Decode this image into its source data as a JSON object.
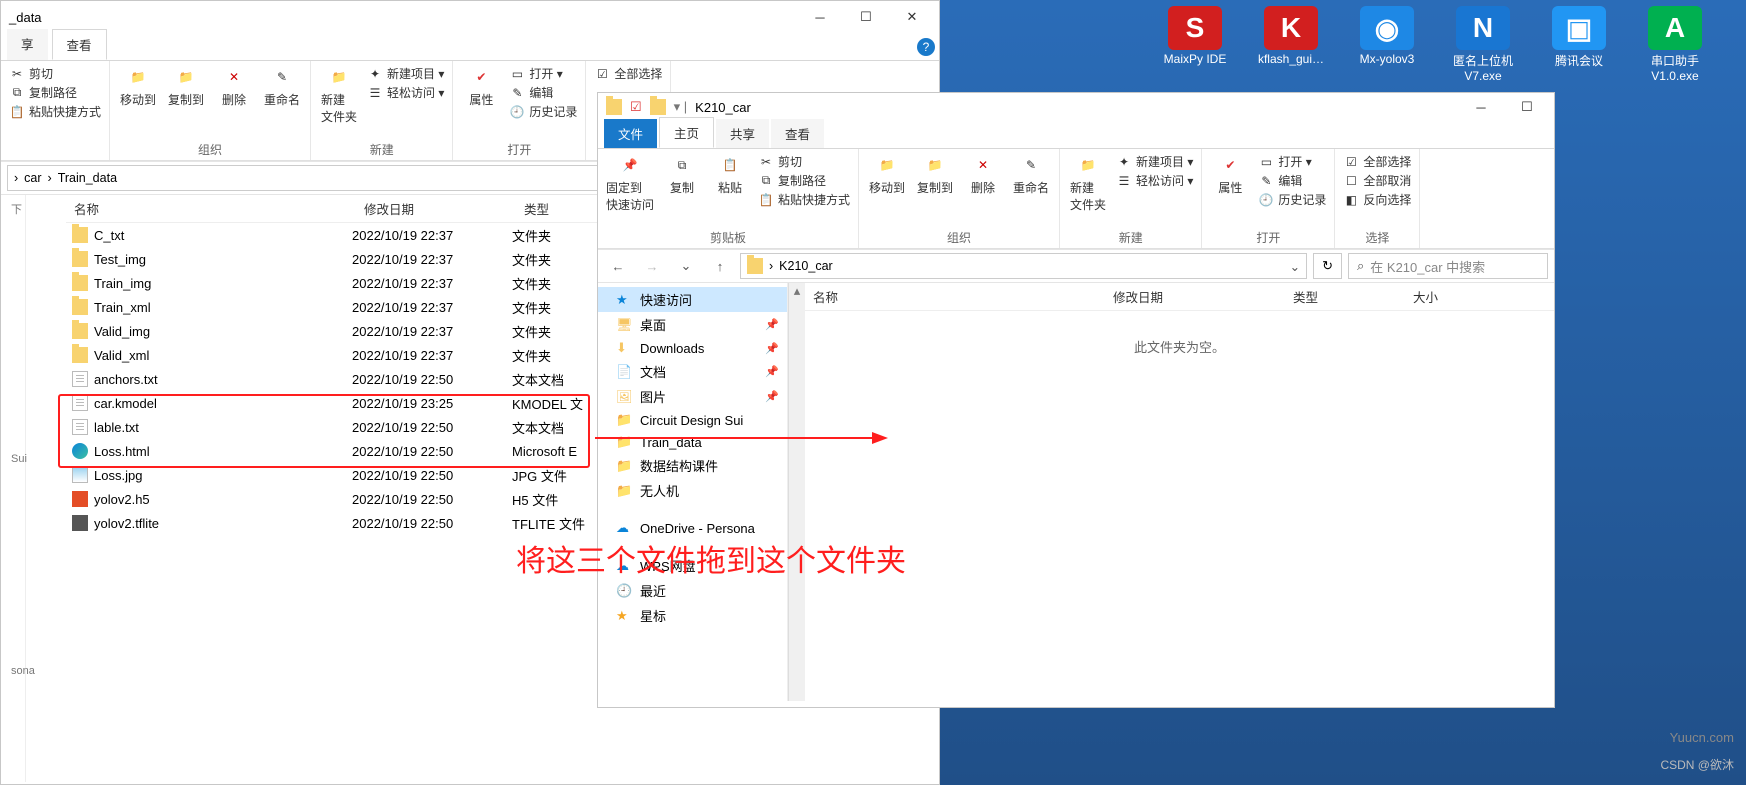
{
  "desktop": {
    "icons": [
      {
        "name": "MaixPy IDE",
        "color": "#d21f1f",
        "glyph": "S"
      },
      {
        "name": "kflash_gui…",
        "color": "#d21f1f",
        "glyph": "K"
      },
      {
        "name": "Mx-yolov3",
        "color": "#1e88e5",
        "glyph": "◉"
      },
      {
        "name": "匿名上位机\nV7.exe",
        "color": "#1976d2",
        "glyph": "N"
      },
      {
        "name": "腾讯会议",
        "color": "#2196f3",
        "glyph": "▣"
      },
      {
        "name": "串口助手\nV1.0.exe",
        "color": "#00b050",
        "glyph": "A"
      }
    ]
  },
  "winA": {
    "title": "_data",
    "tabs": [
      "享",
      "查看"
    ],
    "ribbon": {
      "clipboard": {
        "cut": "剪切",
        "copy": "复制路径",
        "paste": "粘贴快捷方式"
      },
      "org": {
        "move": "移动到",
        "copy": "复制到",
        "del": "删除",
        "rename": "重命名",
        "label": "组织"
      },
      "new": {
        "folder": "新建\n文件夹",
        "newitem": "新建项目 ▾",
        "easy": "轻松访问 ▾",
        "label": "新建"
      },
      "open": {
        "prop": "属性",
        "open": "打开 ▾",
        "edit": "编辑",
        "history": "历史记录",
        "label": "打开"
      },
      "select": {
        "all": "全部选择"
      }
    },
    "breadcrumb": [
      "car",
      "Train_data"
    ],
    "cols": {
      "name": "名称",
      "date": "修改日期",
      "type": "类型"
    },
    "rows": [
      {
        "i": "folder",
        "n": "C_txt",
        "d": "2022/10/19 22:37",
        "t": "文件夹"
      },
      {
        "i": "folder",
        "n": "Test_img",
        "d": "2022/10/19 22:37",
        "t": "文件夹"
      },
      {
        "i": "folder",
        "n": "Train_img",
        "d": "2022/10/19 22:37",
        "t": "文件夹"
      },
      {
        "i": "folder",
        "n": "Train_xml",
        "d": "2022/10/19 22:37",
        "t": "文件夹"
      },
      {
        "i": "folder",
        "n": "Valid_img",
        "d": "2022/10/19 22:37",
        "t": "文件夹"
      },
      {
        "i": "folder",
        "n": "Valid_xml",
        "d": "2022/10/19 22:37",
        "t": "文件夹"
      },
      {
        "i": "txt",
        "n": "anchors.txt",
        "d": "2022/10/19 22:50",
        "t": "文本文档"
      },
      {
        "i": "txt",
        "n": "car.kmodel",
        "d": "2022/10/19 23:25",
        "t": "KMODEL 文"
      },
      {
        "i": "txt",
        "n": "lable.txt",
        "d": "2022/10/19 22:50",
        "t": "文本文档"
      },
      {
        "i": "edge",
        "n": "Loss.html",
        "d": "2022/10/19 22:50",
        "t": "Microsoft E"
      },
      {
        "i": "jpg",
        "n": "Loss.jpg",
        "d": "2022/10/19 22:50",
        "t": "JPG 文件"
      },
      {
        "i": "h5",
        "n": "yolov2.h5",
        "d": "2022/10/19 22:50",
        "t": "H5 文件"
      },
      {
        "i": "tfl",
        "n": "yolov2.tflite",
        "d": "2022/10/19 22:50",
        "t": "TFLITE 文件"
      }
    ],
    "sidebarLabels": [
      "下",
      "Sui",
      "sona"
    ]
  },
  "winB": {
    "title": "K210_car",
    "tabStrip": {
      "file": "文件",
      "home": "主页",
      "share": "共享",
      "view": "查看"
    },
    "ribbon": {
      "clip": {
        "pin": "固定到\n快速访问",
        "copy": "复制",
        "paste": "粘贴",
        "cut": "剪切",
        "copypath": "复制路径",
        "pastesc": "粘贴快捷方式",
        "label": "剪贴板"
      },
      "org": {
        "move": "移动到",
        "copy": "复制到",
        "del": "删除",
        "rename": "重命名",
        "label": "组织"
      },
      "new": {
        "folder": "新建\n文件夹",
        "newitem": "新建项目 ▾",
        "easy": "轻松访问 ▾",
        "label": "新建"
      },
      "open": {
        "prop": "属性",
        "open": "打开 ▾",
        "edit": "编辑",
        "history": "历史记录",
        "label": "打开"
      },
      "select": {
        "all": "全部选择",
        "none": "全部取消",
        "inv": "反向选择",
        "label": "选择"
      }
    },
    "breadcrumb": [
      "K210_car"
    ],
    "search": {
      "placeholder": "在 K210_car 中搜索"
    },
    "cols": {
      "name": "名称",
      "date": "修改日期",
      "type": "类型",
      "size": "大小"
    },
    "emptyMsg": "此文件夹为空。",
    "tree": [
      {
        "ico": "star",
        "label": "快速访问",
        "sel": true
      },
      {
        "ico": "desk",
        "label": "桌面",
        "pin": true
      },
      {
        "ico": "dl",
        "label": "Downloads",
        "pin": true
      },
      {
        "ico": "doc",
        "label": "文档",
        "pin": true
      },
      {
        "ico": "pic",
        "label": "图片",
        "pin": true
      },
      {
        "ico": "folder",
        "label": "Circuit Design Sui"
      },
      {
        "ico": "folder",
        "label": "Train_data"
      },
      {
        "ico": "folder",
        "label": "数据结构课件"
      },
      {
        "ico": "folder",
        "label": "无人机"
      },
      {
        "ico": "cloud",
        "label": "OneDrive - Persona",
        "top": true
      },
      {
        "ico": "wps",
        "label": "WPS网盘",
        "top": true
      },
      {
        "ico": "recent",
        "label": "最近"
      },
      {
        "ico": "fav",
        "label": "星标"
      }
    ]
  },
  "annotation": {
    "text": "将这三个文件拖到这个文件夹"
  },
  "watermark": "Yuucn.com",
  "csdn": "CSDN @欲沐"
}
